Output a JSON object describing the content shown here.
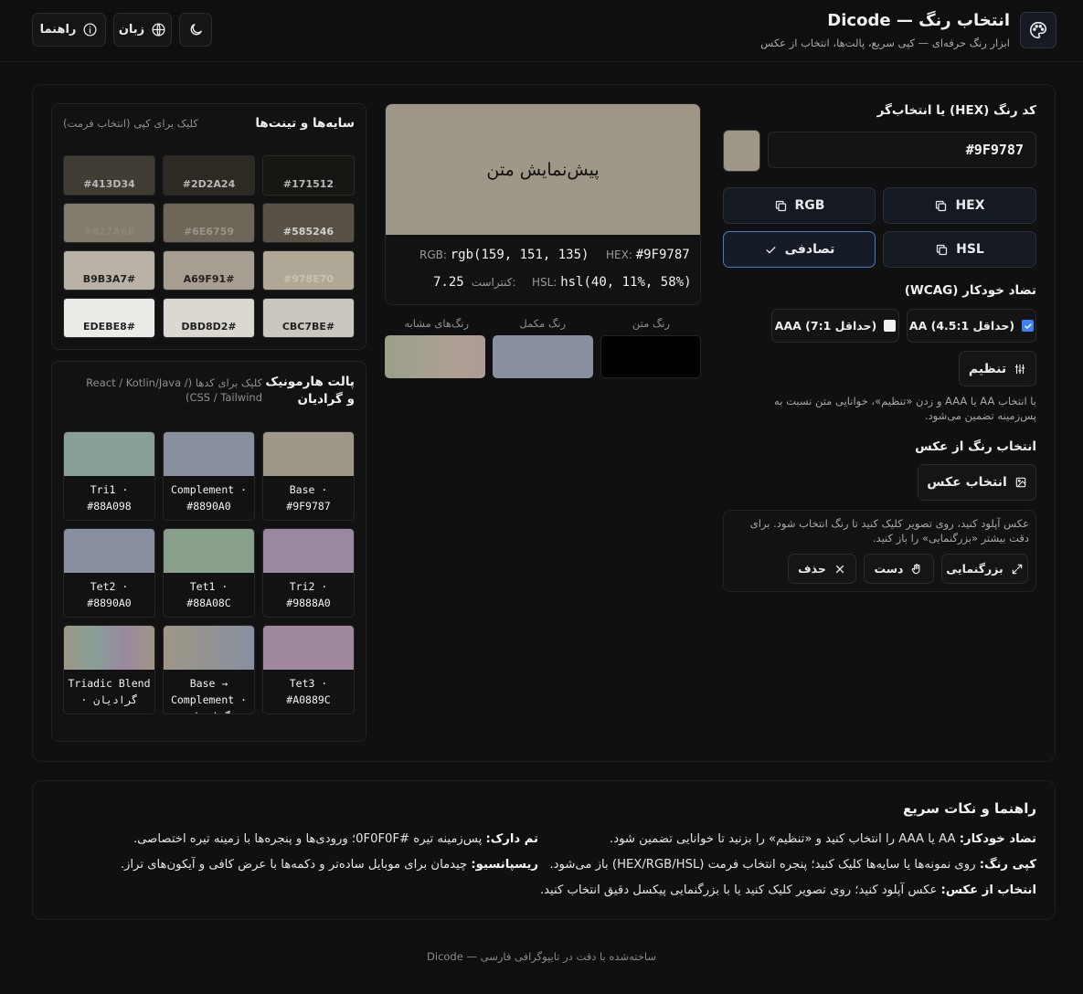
{
  "header": {
    "title": "انتخاب رنگ — Dicode",
    "subtitle": "ابزار رنگ حرفه‌ای — کپی سریع، پالت‌ها، انتخاب از عکس",
    "guide_label": "راهنما",
    "language_label": "زبان",
    "logo_icon": "palette-icon",
    "theme_icon": "moon-icon"
  },
  "color_input": {
    "title": "کد رنگ (HEX) یا انتخاب‌گر",
    "value": "#9F9787",
    "swatch_color": "#9F9787",
    "buttons": {
      "hex": "HEX",
      "rgb": "RGB",
      "hsl": "HSL",
      "random": "تصادفی"
    }
  },
  "contrast": {
    "title": "تضاد خودکار (WCAG)",
    "aa_label": "AA (حداقل 4.5:1)",
    "aa_checked": true,
    "aaa_label": "AAA (حداقل 7:1)",
    "aaa_checked": false,
    "adjust_label": "تنظیم",
    "help": "با انتخاب AA یا AAA و زدن «تنظیم»، خوانایی متن نسبت به پس‌زمینه تضمین می‌شود."
  },
  "image_pick": {
    "title": "انتخاب رنگ از عکس",
    "choose_label": "انتخاب عکس",
    "info": "عکس آپلود کنید، روی تصویر کلیک کنید تا رنگ انتخاب شود. برای دقت بیشتر «بزرگنمایی» را باز کنید.",
    "zoom_label": "بزرگنمایی",
    "hand_label": "دست",
    "delete_label": "حذف"
  },
  "preview": {
    "text": "پیش‌نمایش متن",
    "bg": "#9F9787",
    "hex_label": "HEX:",
    "hex_value": "#9F9787",
    "rgb_label": "RGB:",
    "rgb_value": "rgb(159, 151, 135)",
    "hsl_label": "HSL:",
    "hsl_value": "hsl(40, 11%, 58%)",
    "contrast_label": "کنتراست:",
    "contrast_value": "7.25",
    "text_color_label": "رنگ متن",
    "text_color": "#000000",
    "complement_label": "رنگ مکمل",
    "complement_color": "#8890A0",
    "similar_label": "رنگ‌های مشابه"
  },
  "shades": {
    "title": "سایه‌ها و تینت‌ها",
    "hint": "کلیک برای کپی (انتخاب فرمت)",
    "items": [
      {
        "hex": "#171512"
      },
      {
        "hex": "#2D2A24"
      },
      {
        "hex": "#413D34"
      },
      {
        "hex": "#585246"
      },
      {
        "hex": "#6E6759"
      },
      {
        "hex": "#827A6B"
      },
      {
        "hex": "#978E70"
      },
      {
        "hex": "A69F91#"
      },
      {
        "hex": "B9B3A7#"
      },
      {
        "hex": "CBC7BE#"
      },
      {
        "hex": "DBD8D2#"
      },
      {
        "hex": "EDEBE8#"
      }
    ],
    "colors": [
      "#171512",
      "#2D2A24",
      "#413D34",
      "#585246",
      "#6E6759",
      "#827A6B",
      "#AFA896",
      "#A69F91",
      "#B9B3A7",
      "#CBC7BE",
      "#DBD8D2",
      "#EDEBE8"
    ],
    "text_colors": [
      "#b8b8b8",
      "#b8b8b8",
      "#b8b8b8",
      "#d0d0d0",
      "#9a9387",
      "#8d8577",
      "#c9c2ae",
      "#222222",
      "#222222",
      "#222222",
      "#222222",
      "#222222"
    ]
  },
  "harmony": {
    "title": "پالت هارمونیک و گرادیان",
    "hint": "کلیک برای کدها (/ React / Kotlin/Java CSS / Tailwind)",
    "items": [
      {
        "line1": "Base ·",
        "line2": "#9F9787",
        "color": "#9F9787"
      },
      {
        "line1": "Complement ·",
        "line2": "#8890A0",
        "color": "#8890A0"
      },
      {
        "line1": "Tri1 ·",
        "line2": "#88A098",
        "color": "#88A098"
      },
      {
        "line1": "Tri2 ·",
        "line2": "#9888A0",
        "color": "#9888A0"
      },
      {
        "line1": "Tet1 ·",
        "line2": "#88A08C",
        "color": "#88A08C"
      },
      {
        "line1": "Tet2 ·",
        "line2": "#8890A0",
        "color": "#8890A0"
      },
      {
        "line1": "Tet3 ·",
        "line2": "#A0889C",
        "color": "#A0889C"
      },
      {
        "line1": "Base → Complement ·",
        "line2": "گرادیان",
        "color": "linear-gradient(90deg,#9F9787,#8890A0)"
      },
      {
        "line1": "Triadic Blend",
        "line2": "· گرادیان",
        "color": "linear-gradient(90deg,#9F9787,#88A098,#9888A0,#9F9787)"
      }
    ]
  },
  "guide": {
    "title": "راهنما و نکات سریع",
    "tips": [
      {
        "bold": "تضاد خودکار:",
        "text": " AA یا AAA را انتخاب کنید و «تنظیم» را بزنید تا خوانایی تضمین شود."
      },
      {
        "bold": "تم دارک:",
        "text": " پس‌زمینه تیره #0F0F0F؛ ورودی‌ها و پنجره‌ها با زمینه تیره اختصاصی."
      },
      {
        "bold": "کپی رنگ:",
        "text": " روی نمونه‌ها یا سایه‌ها کلیک کنید؛ پنجره انتخاب فرمت (HEX/RGB/HSL) باز می‌شود."
      },
      {
        "bold": "ریسپانسیو:",
        "text": " چیدمان برای موبایل ساده‌تر و دکمه‌ها با عرض کافی و آیکون‌های تراز."
      },
      {
        "bold": "انتخاب از عکس:",
        "text": " عکس آپلود کنید؛ روی تصویر کلیک کنید یا با بزرگنمایی پیکسل دقیق انتخاب کنید."
      }
    ]
  },
  "footer": "ساخته‌شده با دقت در تایپوگرافی فارسی — Dicode"
}
